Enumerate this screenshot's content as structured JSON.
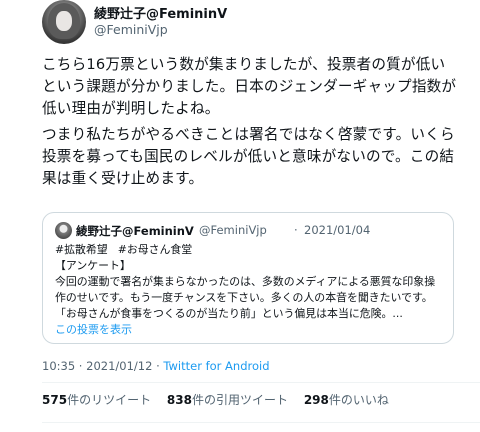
{
  "author": {
    "display_name": "綾野辻子@FemininV",
    "handle": "@FeminiVjp"
  },
  "tweet": {
    "paragraph1": "こちら16万票という数が集まりましたが、投票者の質が低いという課題が分かりました。日本のジェンダーギャップ指数が低い理由が判明したよね。",
    "paragraph2": "つまり私たちがやるべきことは署名ではなく啓蒙です。いくら投票を募っても国民のレベルが低いと意味がないので。この結果は重く受け止めます。"
  },
  "quote": {
    "display_name": "綾野辻子@FemininV",
    "handle": "@FeminiVjp",
    "dot": "·",
    "date": "2021/01/04",
    "tags": [
      "#拡散希望",
      "#お母さん食堂"
    ],
    "line1": "【アンケート】",
    "body": "今回の運動で署名が集まらなかったのは、多数のメディアによる悪質な印象操作のせいです。もう一度チャンスを下さい。多くの人の本音を聞きたいです。「お母さんが食事をつくるのが当たり前」という偏見は本当に危険。...",
    "show_poll": "この投票を表示"
  },
  "meta": {
    "time": "10:35",
    "dot": " · ",
    "date": "2021/01/12",
    "source": "Twitter for Android"
  },
  "stats": {
    "retweets_count": "575",
    "retweets_label": "件のリツイート",
    "quotes_count": "838",
    "quotes_label": "件の引用ツイート",
    "likes_count": "298",
    "likes_label": "件のいいね"
  }
}
